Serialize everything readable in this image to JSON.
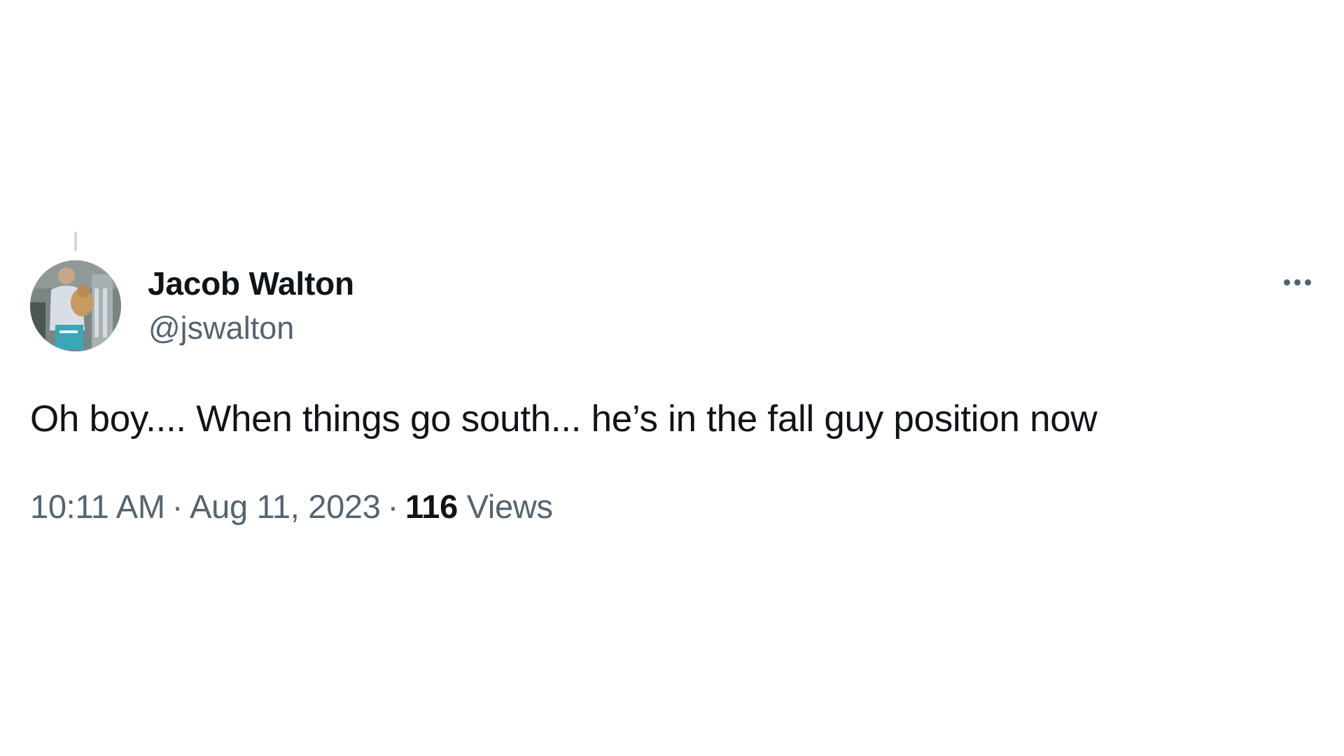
{
  "tweet": {
    "author_name": "Jacob Walton",
    "author_handle": "@jswalton",
    "text": "Oh boy.... When things go south... he’s in the fall guy position now",
    "time": "10:11 AM",
    "separator": "·",
    "date": "Aug 11, 2023",
    "views_count": "116",
    "views_label": "Views"
  },
  "icons": {
    "more": "more-horizontal-icon",
    "avatar": "profile-photo"
  },
  "colors": {
    "text_primary": "#0f1419",
    "text_secondary": "#536471",
    "thread_line": "#cfd9de",
    "background": "#ffffff"
  }
}
